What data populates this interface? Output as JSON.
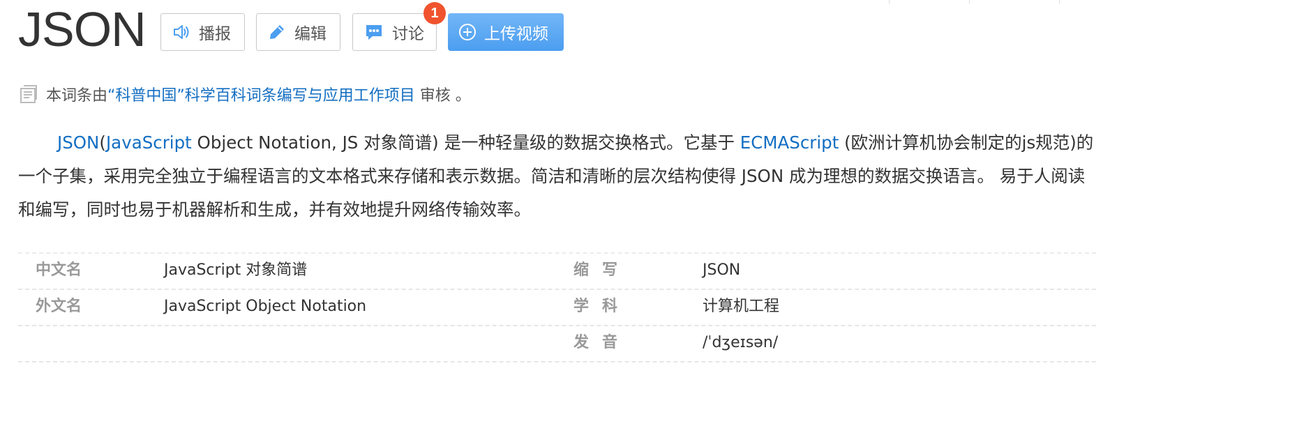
{
  "header": {
    "title": "JSON",
    "buttons": {
      "broadcast": "播报",
      "edit": "编辑",
      "discuss": "讨论",
      "upload": "上传视频"
    },
    "discuss_badge": "1"
  },
  "review": {
    "prefix": "本词条由",
    "org_link": "“科普中国”科学百科词条编写与应用工作项目",
    "suffix": " 审核 。"
  },
  "summary": {
    "link_json": "JSON",
    "open_paren": "(",
    "link_javascript": "JavaScript",
    "text1": " Object Notation, JS 对象简谱) 是一种轻量级的数据交换格式。它基于 ",
    "link_ecmascript": "ECMAScript",
    "text2": " (欧洲计算机协会制定的js规范)的一个子集，采用完全独立于编程语言的文本格式来存储和表示数据。简洁和清晰的层次结构使得 JSON 成为理想的数据交换语言。 易于人阅读和编写，同时也易于机器解析和生成，并有效地提升网络传输效率。"
  },
  "info": {
    "rows": [
      {
        "left_label": "中文名",
        "left_value": "JavaScript 对象简谱",
        "right_label": "缩写",
        "right_value": "JSON"
      },
      {
        "left_label": "外文名",
        "left_value": "JavaScript Object Notation",
        "right_label": "学科",
        "right_value": "计算机工程"
      },
      {
        "left_label": "",
        "left_value": "",
        "right_label": "发音",
        "right_value": "/ˈdʒeɪsən/"
      }
    ]
  },
  "colors": {
    "link": "#136ec2",
    "upload_button": "#4b9ef0",
    "badge": "#f0532e",
    "label": "#999999"
  },
  "icons": [
    "speaker-icon",
    "pencil-icon",
    "chat-bubble-icon",
    "plus-circle-icon",
    "document-icon"
  ]
}
